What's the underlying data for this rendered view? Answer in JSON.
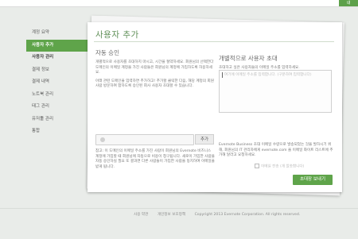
{
  "topbar": {
    "button_label": "내"
  },
  "sidebar": {
    "items": [
      {
        "label": "계정 요약",
        "active": false
      },
      {
        "label": "사용자 추가",
        "active": true
      },
      {
        "label": "사용자 관리",
        "active": false
      },
      {
        "label": "결제 정보",
        "active": false
      },
      {
        "label": "결제 내역",
        "active": false
      },
      {
        "label": "노트북 관리",
        "active": false
      },
      {
        "label": "태그 관리",
        "active": false
      },
      {
        "label": "유저툴 관리",
        "active": false
      },
      {
        "label": "통합",
        "active": false
      }
    ]
  },
  "panel": {
    "title": "사용자 추가",
    "left": {
      "heading": "자동 승인",
      "para1": "개별적으로 사용자를 초대하지 마시고, 시간을 절약하세요. 회원님의 선택한다 도메인의 이메일 계정을 가진 사람들은 회원님의 계정에 가입하도록 허용하세요.",
      "para2": "아래 관련 도메인을 입력하면 추가하고! 추가할 클릭한 다음, 해당 계정의 회원사람 방문하여 합하도록 승인된 회사 사용자 초대할 수 있습니다.",
      "add_label": "추가",
      "footer": "참고: 이 도메인의 이메일 주소를 가진 사람이 회원님의 Evernote 비즈니스 계정에 가입할 때 회원님에 자동으로 비용이 청구됩니다. 새로이 가입한 사람을 자동 승인하실 필요 또 결과면 다른 사람들이 가입한 사람을 동지하여 이메일을 받게 됩니다."
    },
    "right": {
      "heading": "개별적으로 사용자 초대",
      "subtext": "초대하고 싶은 사용자들의 이메일 주소를 입력하세요.",
      "textarea_placeholder": "여기에 이메일 주소를 입력합니다. (구분하여 입력합니다)",
      "footer": "Evernote Business 초대 이메일 수량으로 발송되었는 것을 발하시기 위해, 회원님의 IT 관리자에게 evernote.com 을 이메일 화이트 리스트에 추가해 달라고 요청하세요.",
      "checkbox_label": "이메일 전송 (개 발송합니다)",
      "send_label": "초대장 보내기"
    }
  },
  "footer": {
    "links": [
      "사용 약관",
      "개인정보 보호정책",
      "Copyright 2013 Evernote Corporation. All rights reserved."
    ]
  }
}
